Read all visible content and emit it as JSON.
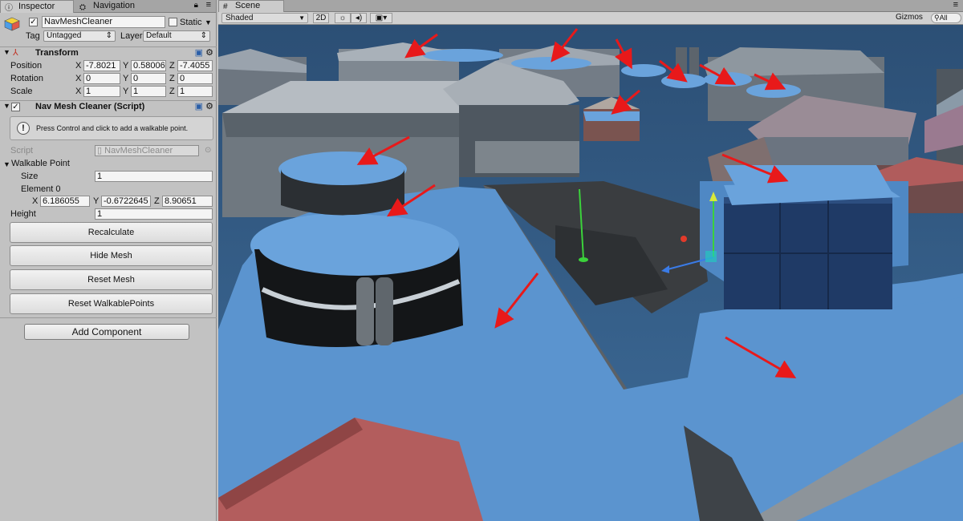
{
  "inspector": {
    "tab_label": "Inspector",
    "tab_navigation": "Navigation",
    "object_name": "NavMeshCleaner",
    "static_label": "Static",
    "tag_label": "Tag",
    "tag_value": "Untagged",
    "layer_label": "Layer",
    "layer_value": "Default",
    "transform": {
      "title": "Transform",
      "position_label": "Position",
      "rotation_label": "Rotation",
      "scale_label": "Scale",
      "position": {
        "x": "-7.8021",
        "y": "0.58006",
        "z": "-7.4055"
      },
      "rotation": {
        "x": "0",
        "y": "0",
        "z": "0"
      },
      "scale": {
        "x": "1",
        "y": "1",
        "z": "1"
      },
      "axis_x": "X",
      "axis_y": "Y",
      "axis_z": "Z"
    },
    "script_component": {
      "title": "Nav Mesh Cleaner (Script)",
      "help_text": "Press Control and click to add a walkable point.",
      "script_label": "Script",
      "script_value": "NavMeshCleaner",
      "walkable_point_label": "Walkable Point",
      "size_label": "Size",
      "size_value": "1",
      "element0_label": "Element 0",
      "element0": {
        "x": "6.186055",
        "y": "-0.6722645",
        "z": "8.90651"
      },
      "height_label": "Height",
      "height_value": "1"
    },
    "buttons": {
      "recalculate": "Recalculate",
      "hide_mesh": "Hide Mesh",
      "reset_mesh": "Reset Mesh",
      "reset_walkable_points": "Reset WalkablePoints"
    },
    "add_component": "Add Component"
  },
  "scene": {
    "tab_label": "Scene",
    "shading_mode": "Shaded",
    "mode_2d": "2D",
    "gizmos_label": "Gizmos",
    "search_placeholder": "All"
  },
  "colors": {
    "navmesh_blue": "#5b94cf",
    "arrow_red": "#e8191a",
    "editor_gray": "#c2c2c2"
  }
}
